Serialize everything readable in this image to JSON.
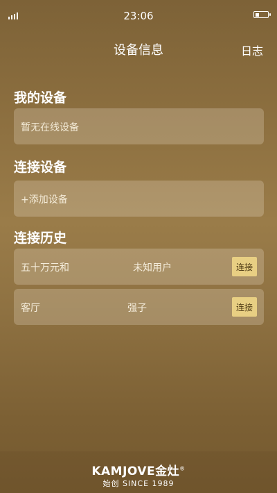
{
  "status_bar": {
    "time": "23:06",
    "battery_icon": "battery-icon",
    "signal_icon": "signal-icon"
  },
  "nav": {
    "title": "设备信息",
    "log_label": "日志"
  },
  "my_devices": {
    "title": "我的设备",
    "empty_text": "暂无在线设备"
  },
  "connect_device": {
    "title": "连接设备",
    "add_label": "+添加设备"
  },
  "history": {
    "title": "连接历史",
    "rows": [
      {
        "name": "五十万元和",
        "user": "未知用户",
        "button": "连接"
      },
      {
        "name": "客厅",
        "user": "强子",
        "button": "连接"
      }
    ]
  },
  "footer": {
    "brand": "KAMJOVE金灶",
    "registered": "®",
    "tagline": "始创  SINCE  1989"
  },
  "colors": {
    "accent_button": "#e8cf83",
    "background": "#8f7242"
  }
}
